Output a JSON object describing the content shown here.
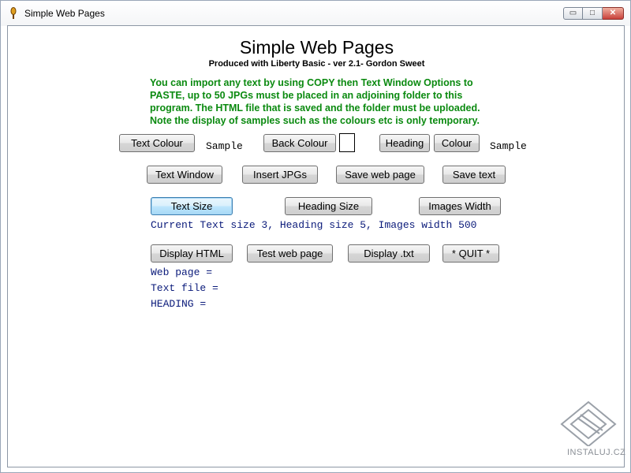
{
  "window": {
    "title": "Simple Web Pages",
    "controls": {
      "minimize": "▭",
      "maximize": "□",
      "close": "✕"
    }
  },
  "header": {
    "title": "Simple Web Pages",
    "subtitle": "Produced with Liberty Basic - ver 2.1- Gordon Sweet"
  },
  "intro": {
    "lines": [
      "You can import any text by using COPY then Text Window Options to",
      "PASTE, up to 50 JPGs must be placed in an adjoining folder to this",
      "program. The HTML file that is saved and the folder must be uploaded.",
      "Note the display of samples such as the colours etc is only temporary."
    ],
    "color": "#0b8a10"
  },
  "row1": {
    "text_colour": "Text Colour",
    "sample_left": "Sample",
    "back_colour": "Back Colour",
    "heading": "Heading",
    "colour": "Colour",
    "sample_right": "Sample"
  },
  "row2": {
    "text_window": "Text Window",
    "insert_jpgs": "Insert JPGs",
    "save_web_page": "Save web page",
    "save_text": "Save text"
  },
  "row3": {
    "text_size": "Text Size",
    "heading_size": "Heading Size",
    "images_width": "Images Width",
    "status": "Current Text size 3, Heading size 5, Images width 500"
  },
  "row4": {
    "display_html": "Display HTML",
    "test_web_page": "Test web page",
    "display_txt": "Display .txt",
    "quit": "* QUIT *"
  },
  "info": {
    "web_page": "Web page =",
    "text_file": "Text file =",
    "heading": "HEADING ="
  },
  "watermark": {
    "text": "INSTALUJ.CZ"
  },
  "colors": {
    "status_text": "#0a1a7a",
    "focus_border": "#3c7fb1"
  }
}
